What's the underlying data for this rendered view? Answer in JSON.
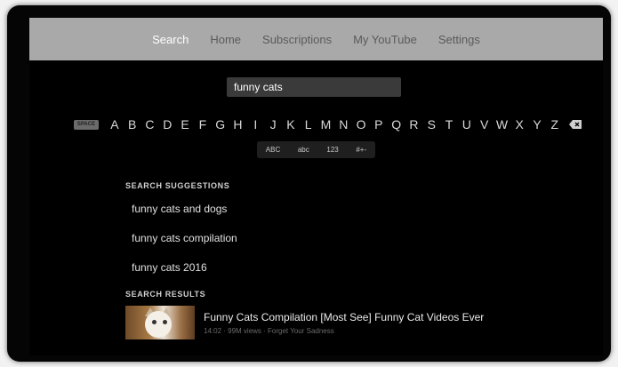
{
  "nav": {
    "tabs": [
      {
        "label": "Search",
        "active": true
      },
      {
        "label": "Home",
        "active": false
      },
      {
        "label": "Subscriptions",
        "active": false
      },
      {
        "label": "My YouTube",
        "active": false
      },
      {
        "label": "Settings",
        "active": false
      }
    ]
  },
  "search": {
    "query": "funny cats"
  },
  "keyboard": {
    "space_label": "SPACE",
    "letters": [
      "A",
      "B",
      "C",
      "D",
      "E",
      "F",
      "G",
      "H",
      "I",
      "J",
      "K",
      "L",
      "M",
      "N",
      "O",
      "P",
      "Q",
      "R",
      "S",
      "T",
      "U",
      "V",
      "W",
      "X",
      "Y",
      "Z"
    ],
    "delete_icon": "backspace-icon",
    "modes": [
      "ABC",
      "abc",
      "123",
      "#+-"
    ]
  },
  "suggestions": {
    "header": "SEARCH SUGGESTIONS",
    "items": [
      "funny cats and dogs",
      "funny cats compilation",
      "funny cats 2016"
    ]
  },
  "results": {
    "header": "SEARCH RESULTS",
    "items": [
      {
        "title": "Funny Cats Compilation [Most See] Funny Cat Videos Ever",
        "meta": "14:02 · 99M views · Forget Your Sadness",
        "thumbnail": "cat-thumbnail"
      }
    ]
  },
  "colors": {
    "nav_bar": "#a9a9a9",
    "nav_active": "#ffffff",
    "nav_inactive": "#5a5a5a",
    "background": "#000000"
  }
}
